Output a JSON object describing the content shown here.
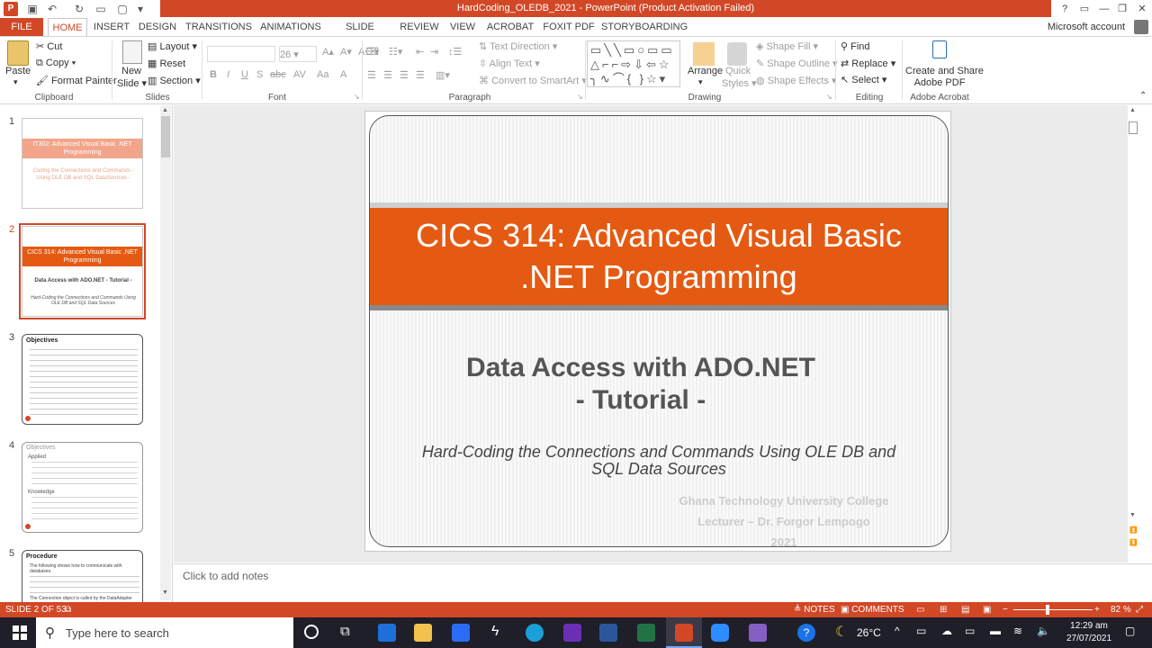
{
  "titlebar": {
    "title": "HardCoding_OLEDB_2021 - PowerPoint (Product Activation Failed)",
    "controls": [
      "?",
      "▭",
      "—",
      "❐",
      "✕"
    ]
  },
  "tabs": [
    "FILE",
    "HOME",
    "INSERT",
    "DESIGN",
    "TRANSITIONS",
    "ANIMATIONS",
    "SLIDE SHOW",
    "REVIEW",
    "VIEW",
    "ACROBAT",
    "FOXIT PDF",
    "STORYBOARDING"
  ],
  "account": "Microsoft account",
  "ribbon": {
    "clipboard": {
      "paste": "Paste",
      "cut": "Cut",
      "copy": "Copy",
      "format_painter": "Format Painter",
      "label": "Clipboard"
    },
    "slides": {
      "new_slide": "New",
      "new_slide2": "Slide",
      "layout": "Layout",
      "reset": "Reset",
      "section": "Section",
      "label": "Slides"
    },
    "font": {
      "size": "26",
      "label": "Font",
      "bold": "B",
      "italic": "I",
      "underline": "U",
      "strike": "S",
      "aa": "AV",
      "aa2": "Aa",
      "color": "A"
    },
    "paragraph": {
      "text_direction": "Text Direction",
      "align_text": "Align Text",
      "smartart": "Convert to SmartArt",
      "label": "Paragraph"
    },
    "drawing": {
      "arrange": "Arrange",
      "quick": "Quick",
      "styles": "Styles",
      "shape_fill": "Shape Fill",
      "shape_outline": "Shape Outline",
      "shape_effects": "Shape Effects",
      "label": "Drawing"
    },
    "editing": {
      "find": "Find",
      "replace": "Replace",
      "select": "Select",
      "label": "Editing"
    },
    "acrobat": {
      "create1": "Create and Share",
      "create2": "Adobe PDF",
      "label": "Adobe Acrobat"
    }
  },
  "thumbnails": [
    {
      "num": "1",
      "title": "IT302: Advanced Visual Basic .NET Programming",
      "sub": "Coding the Connections and Commands - Using OLE DB and SQL DataSources -"
    },
    {
      "num": "2",
      "title": "CICS 314: Advanced Visual Basic .NET Programming",
      "sub": "Data Access with ADO.NET - Tutorial -",
      "sub2": "Hard-Coding the Connections and Commands Using OLE DB and SQL Data Sources"
    },
    {
      "num": "3",
      "title": "Objectives"
    },
    {
      "num": "4",
      "title": "Objectives",
      "applied": "Applied",
      "knowledge": "Knowledge"
    },
    {
      "num": "5",
      "title": "Procedure",
      "line1": "The following shows how to communicate with databases.",
      "line2": "The Connection object is called by the DataAdapter"
    }
  ],
  "slide": {
    "title_line1": "CICS 314: Advanced Visual Basic",
    "title_line2": ".NET Programming",
    "subtitle_line1": "Data Access with ADO.NET",
    "subtitle_line2": "- Tutorial -",
    "italic_line1": "Hard-Coding the Connections and Commands Using OLE DB and",
    "italic_line2": "SQL Data Sources",
    "college": "Ghana Technology University College",
    "lecturer": "Lecturer – Dr.  Forgor Lempogo",
    "year": "2021"
  },
  "notes_placeholder": "Click to add notes",
  "status": {
    "slide_counter": "SLIDE 2 OF 53",
    "notes": "NOTES",
    "comments": "COMMENTS",
    "zoom": "82 %"
  },
  "taskbar": {
    "search_placeholder": "Type here to search",
    "temperature": "26°C",
    "time": "12:29 am",
    "date": "27/07/2021"
  },
  "colors": {
    "accent": "#d24726",
    "band": "#e55a12",
    "taskbar": "#1f1f2a"
  }
}
